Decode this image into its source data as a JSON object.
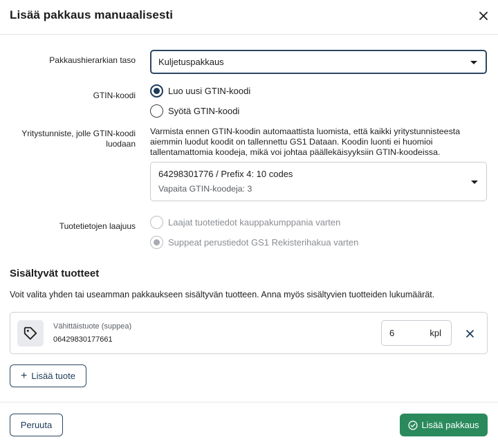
{
  "dialog": {
    "title": "Lisää pakkaus manuaalisesti"
  },
  "form": {
    "hierarchy": {
      "label": "Pakkaushierarkian taso",
      "value": "Kuljetuspakkaus"
    },
    "gtin": {
      "label": "GTIN-koodi",
      "options": [
        "Luo uusi GTIN-koodi",
        "Syötä GTIN-koodi"
      ],
      "selected": "Luo uusi GTIN-koodi"
    },
    "company": {
      "label": "Yritystunniste, jolle GTIN-koodi luodaan",
      "info": "Varmista ennen GTIN-koodin automaattista luomista, että kaikki yritystunnisteesta aiemmin luodut koodit on tallennettu GS1 Dataan. Koodin luonti ei huomioi tallentamattomia koodeja, mikä voi johtaa päällekäisyyksiin GTIN-koodeissa.",
      "value": "64298301776 / Prefix 4: 10 codes",
      "available": "Vapaita GTIN-koodeja: 3"
    },
    "scope": {
      "label": "Tuotetietojen laajuus",
      "options": [
        "Laajat tuotetiedot kauppakumppania varten",
        "Suppeat perustiedot GS1 Rekisterihakua varten"
      ],
      "selected": "Suppeat perustiedot GS1 Rekisterihakua varten",
      "disabled": true
    }
  },
  "products": {
    "title": "Sisältyvät tuotteet",
    "description": "Voit valita yhden tai useamman pakkaukseen sisältyvän tuotteen. Anna myös sisältyvien tuotteiden lukumäärät.",
    "items": [
      {
        "type": "Vähittäistuote (suppea)",
        "code": "06429830177661",
        "quantity": "6",
        "unit": "kpl",
        "icon": "tag-icon"
      }
    ],
    "add_label": "Lisää tuote"
  },
  "footer": {
    "cancel_label": "Peruuta",
    "submit_label": "Lisää pakkaus"
  },
  "colors": {
    "primary_navy": "#1d3a58",
    "success_green": "#2a8a5c",
    "border_gray": "#c8ccd1"
  }
}
